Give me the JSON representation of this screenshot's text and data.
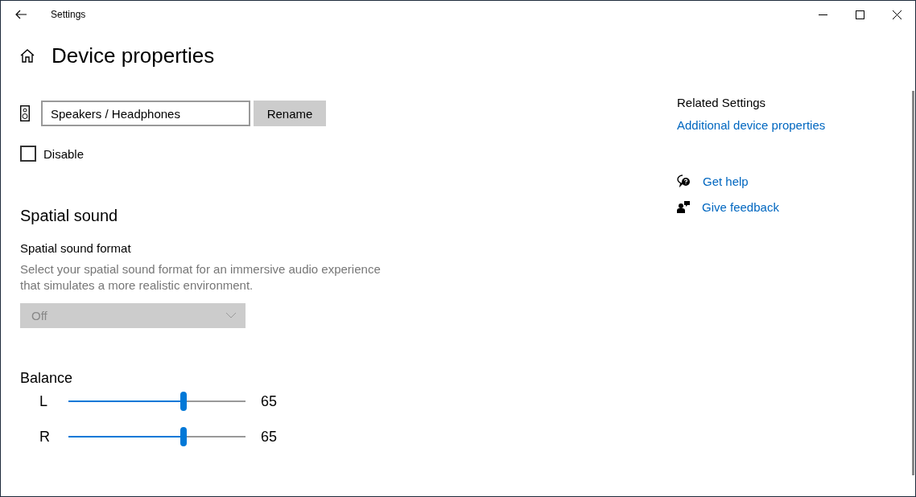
{
  "window": {
    "title": "Settings"
  },
  "page": {
    "title": "Device properties"
  },
  "device": {
    "name": "Speakers / Headphones",
    "rename_button": "Rename"
  },
  "disable": {
    "label": "Disable",
    "checked": false
  },
  "spatial_sound": {
    "heading": "Spatial sound",
    "format_label": "Spatial sound format",
    "description": "Select your spatial sound format for an immersive audio experience that simulates a more realistic environment.",
    "dropdown": {
      "value": "Off",
      "disabled": true
    }
  },
  "balance": {
    "heading": "Balance",
    "channels": [
      {
        "name": "L",
        "level": 0.65,
        "reading": "65"
      },
      {
        "name": "R",
        "level": 0.65,
        "reading": "65"
      }
    ]
  },
  "related": {
    "heading": "Related Settings",
    "links": [
      "Additional device properties"
    ]
  },
  "help": [
    {
      "kind": "help",
      "label": "Get help"
    },
    {
      "kind": "feedback",
      "label": "Give feedback"
    }
  ]
}
